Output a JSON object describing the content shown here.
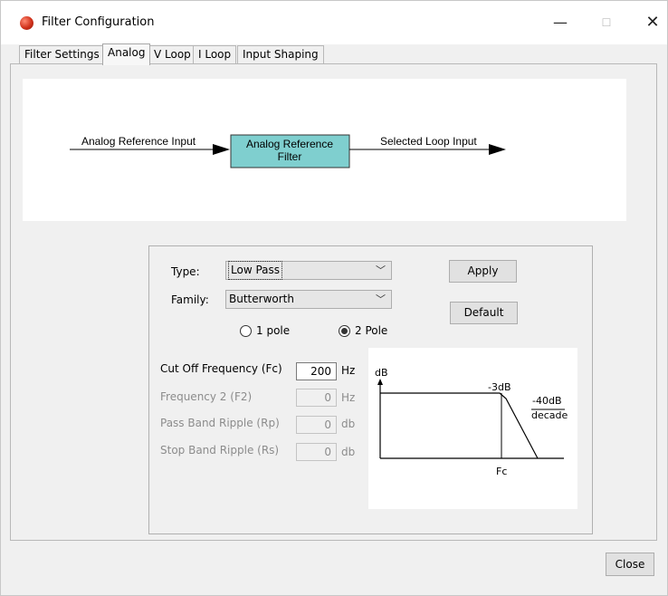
{
  "window": {
    "title": "Filter Configuration",
    "minimize": "—",
    "maximize": "☐",
    "close": "✕"
  },
  "tabs": [
    {
      "label": "Filter Settings"
    },
    {
      "label": "Analog"
    },
    {
      "label": "V Loop"
    },
    {
      "label": "I Loop"
    },
    {
      "label": "Input Shaping"
    }
  ],
  "active_tab": "Analog",
  "diagram": {
    "input_label": "Analog Reference Input",
    "block_line1": "Analog Reference",
    "block_line2": "Filter",
    "output_label": "Selected Loop Input",
    "block_color": "#7fcfcf"
  },
  "settings": {
    "type_label": "Type:",
    "type_value": "Low Pass",
    "family_label": "Family:",
    "family_value": "Butterworth",
    "apply_label": "Apply",
    "default_label": "Default",
    "pole1_label": "1 pole",
    "pole2_label": "2 Pole",
    "selected_pole": "2 Pole",
    "cutoff_label": "Cut Off Frequency (Fc)",
    "cutoff_value": "200",
    "cutoff_unit": "Hz",
    "f2_label": "Frequency 2  (F2)",
    "f2_value": "0",
    "f2_unit": "Hz",
    "rp_label": "Pass Band Ripple (Rp)",
    "rp_value": "0",
    "rp_unit": "db",
    "rs_label": "Stop Band Ripple (Rs)",
    "rs_value": "0",
    "rs_unit": "db"
  },
  "response_graph": {
    "y_label": "dB",
    "minus3_label": "-3dB",
    "slope_line1": "-40dB",
    "slope_line2": "decade",
    "fc_label": "Fc"
  },
  "footer": {
    "close_label": "Close"
  }
}
